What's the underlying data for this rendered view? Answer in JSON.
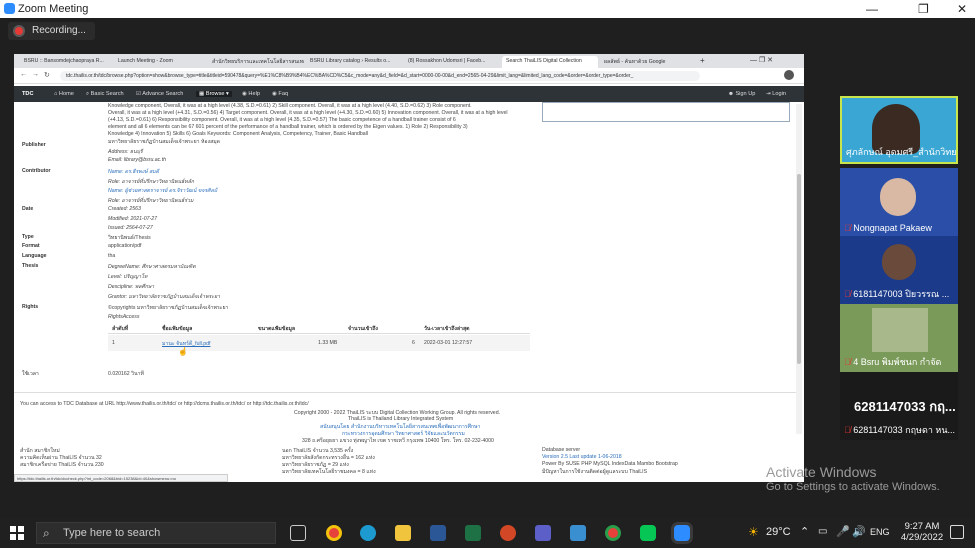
{
  "zoom": {
    "title": "Zoom Meeting",
    "recording": "Recording...",
    "win_min": "—",
    "win_max": "❐",
    "win_close": "✕"
  },
  "browser": {
    "tabs": [
      "BSRU :: Bansomdejchaopraya R...",
      "Launch Meeting - Zoom",
      "สำนักวิทยบริการและเทคโนโลยีสารสนเทศ",
      "BSRU Library catalog › Results o...",
      "(8) Rossakhon Udomsri | Faceb...",
      "Search ThaiLIS Digital Collection",
      "ผลลัพธ์ - ค้นหาด้วย Google"
    ],
    "url": "tdc.thailis.or.th/tdc/browse.php?option=show&browse_type=title&titleid=590478&query=%E1%C8%B9%B4%EC%BA%CD%C5&c_mode=any&d_field=&d_start=0000-00-00&d_end=2565-04-29&limit_lang=&limited_lang_code=&order=&order_type=&order_"
  },
  "navbar": {
    "brand": "TDC",
    "home": "⌂ Home",
    "basic": "⌕ Basic Search",
    "advance": "☑ Advance Search",
    "browse": "▦ Browse ▾",
    "help": "◉ Help",
    "faq": "◉ Faq",
    "signup": "☻ Sign Up",
    "login": "⇥ Login"
  },
  "record": {
    "abstract_lines": [
      "Knowledge component, Overall, it was at a high level (4.38, S.D.=0.61) 2) Skill component. Overall, it was at a high level (4.40, S.D.=0.62) 3) Role component.",
      "Overall, it was at a high level (+4.31, S.D.=0.56) 4) Target component. Overall, it was at a high level (+4.30, S.D.=0.60) 5) Innovation component. Overall, it was at a high level",
      "(+4.13, S.D.=0.61) 6) Responsibility component. Overall, it was at a high level (4.35, S.D.=0.57) The basic competence of a handball trainer consist of 6",
      "element and all 6 elements can be 67 601 percent of the performance of a handball trainer, which is ordered by the Eigen values. 1) Role 2) Responsibility 3)",
      "Knowledge 4) Innovation 5) Skills 6) Goals Keywords: Component Analysis, Competency, Trainer, Basic Handball"
    ],
    "publisher_label": "Publisher",
    "publisher": "มหาวิทยาลัยราชภัฏบ้านสมเด็จเจ้าพระยา ห้องสมุด",
    "address": "Address: ธนบุรี",
    "email": "Email: library@bsru.ac.th",
    "contributor_label": "Contributor",
    "contrib_name1": "Name: ดร.ธีรพงษ์ สมดี",
    "contrib_role1": "Role: อาจารย์ที่ปรึกษาวิทยานิพนธ์หลัก",
    "contrib_name2": "Name: ผู้ช่วยศาสตราจารย์ ดร.จิราวัฒน์ ขจรศิลป์",
    "contrib_role2": "Role: อาจารย์ที่ปรึกษาวิทยานิพนธ์ร่วม",
    "date_label": "Date",
    "created": "Created: 2563",
    "modified": "Modified: 2021-07-27",
    "issued": "Issued: 2564-07-27",
    "type_label": "Type",
    "type": "วิทยานิพนธ์/Thesis",
    "format_label": "Format",
    "format": "application/pdf",
    "language_label": "Language",
    "language": "tha",
    "thesis_label": "Thesis",
    "degree": "DegreeName: ศึกษาศาสตรมหาบัณฑิต",
    "level": "Level: ปริญญาโท",
    "discipline": "Descipline: พลศึกษา",
    "grantor": "Grantor: มหาวิทยาลัยราชภัฏบ้านสมเด็จเจ้าพระยา",
    "rights_label": "Rights",
    "rights": "©copyrights มหาวิทยาลัยราชภัฏบ้านสมเด็จเจ้าพระยา",
    "rights_access": "RightsAccess",
    "table_headers": [
      "ลำดับที่",
      "ชื่อแฟ้มข้อมูล",
      "ขนาดแฟ้มข้อมูล",
      "จำนวนเข้าถึง",
      "วัน-เวลาเข้าถึงล่าสุด"
    ],
    "table_row": [
      "1",
      "มานะ จันทร์ดี_full.pdf",
      "1.33 MB",
      "6",
      "2022-03-01 12:27:57"
    ],
    "time_label": "ใช้เวลา",
    "time_value": "0.020162 วินาที"
  },
  "footer": {
    "access_line": "You can access to TDC Database at URL http://www.thailis.or.th/tdc/ or http://dcms.thailis.or.th/tdc/ or http://tdc.thailis.or.th/tdc/",
    "copyright": "Copyright 2000 - 2022 ThaiLIS ระบบ Digital Collection Working Group. All rights reserved.",
    "thailis": "ThaiLIS is Thailand Library Integrated System",
    "support": "สนับสนุนโดย สำนักงานบริหารเทคโนโลยีสารสนเทศเพื่อพัฒนาการศึกษา",
    "ministry": "กระทรวงการอุดมศึกษา วิทยาศาสตร์ วิจัยและนวัตกรรม",
    "address": "328 ถ.ศรีอยุธยา แขวง ทุ่งพญาไท เขต ราชเทวี กรุงเทพ 10400 โทร. โทร. 02-232-4000",
    "col1_1": "สำนัก สมาชิกใหม่",
    "col1_2": "ความคิดเห็นผ่าน ThaiLIS จำนวน 32",
    "col1_3": "สมาชิกเครือข่าย ThaiLIS จำนวน 230",
    "col2_1": "นอก ThaiLIS จำนวน 3,535 ครั้ง",
    "col2_2": "มหาวิทยาลัยสังกัดกระทรวงอื่น = 162 แห่ง",
    "col2_3": "มหาวิทยาลัยราชภัฏ = 29 แห่ง",
    "col2_4": "มหาวิทยาลัยเทคโนโลยีราชมงคล = 8 แห่ง",
    "col3_1": "Database server",
    "col3_2": "Version 2.5 Last update 1-06-2018",
    "col3_3": "Power By SUSE PHP MySQL IndexData Mambo Bootstrap",
    "col3_4": "มีปัญหาในการใช้งานติดต่อผู้ดูแลระบบ ThaiLIS",
    "status_url": "https://tdc.thailis.or.th/tdc/dccheck.php?int_code=2068&bid=15238&id=40&showmenu=no"
  },
  "participants": [
    {
      "name": "ศุภลักษณ์ อุดมศรี_สำนักวิทยบ...",
      "muted": false,
      "speaking": true
    },
    {
      "name": "Nongnapat Pakaew",
      "muted": true,
      "speaking": false
    },
    {
      "name": "6181147003 ปิยวรรณ ...",
      "muted": true,
      "speaking": false
    },
    {
      "name": "4 Bsru พิมพ์ชนก กำจัด",
      "muted": true,
      "speaking": false
    },
    {
      "name_big": "6281147033 กฤ...",
      "name": "6281147033 กฤษดา หน...",
      "muted": true
    }
  ],
  "windows": {
    "activate_title": "Activate Windows",
    "activate_sub": "Go to Settings to activate Windows.",
    "search_placeholder": "Type here to search",
    "weather": "29°C",
    "lang": "ENG",
    "time": "9:27 AM",
    "date": "4/29/2022"
  }
}
